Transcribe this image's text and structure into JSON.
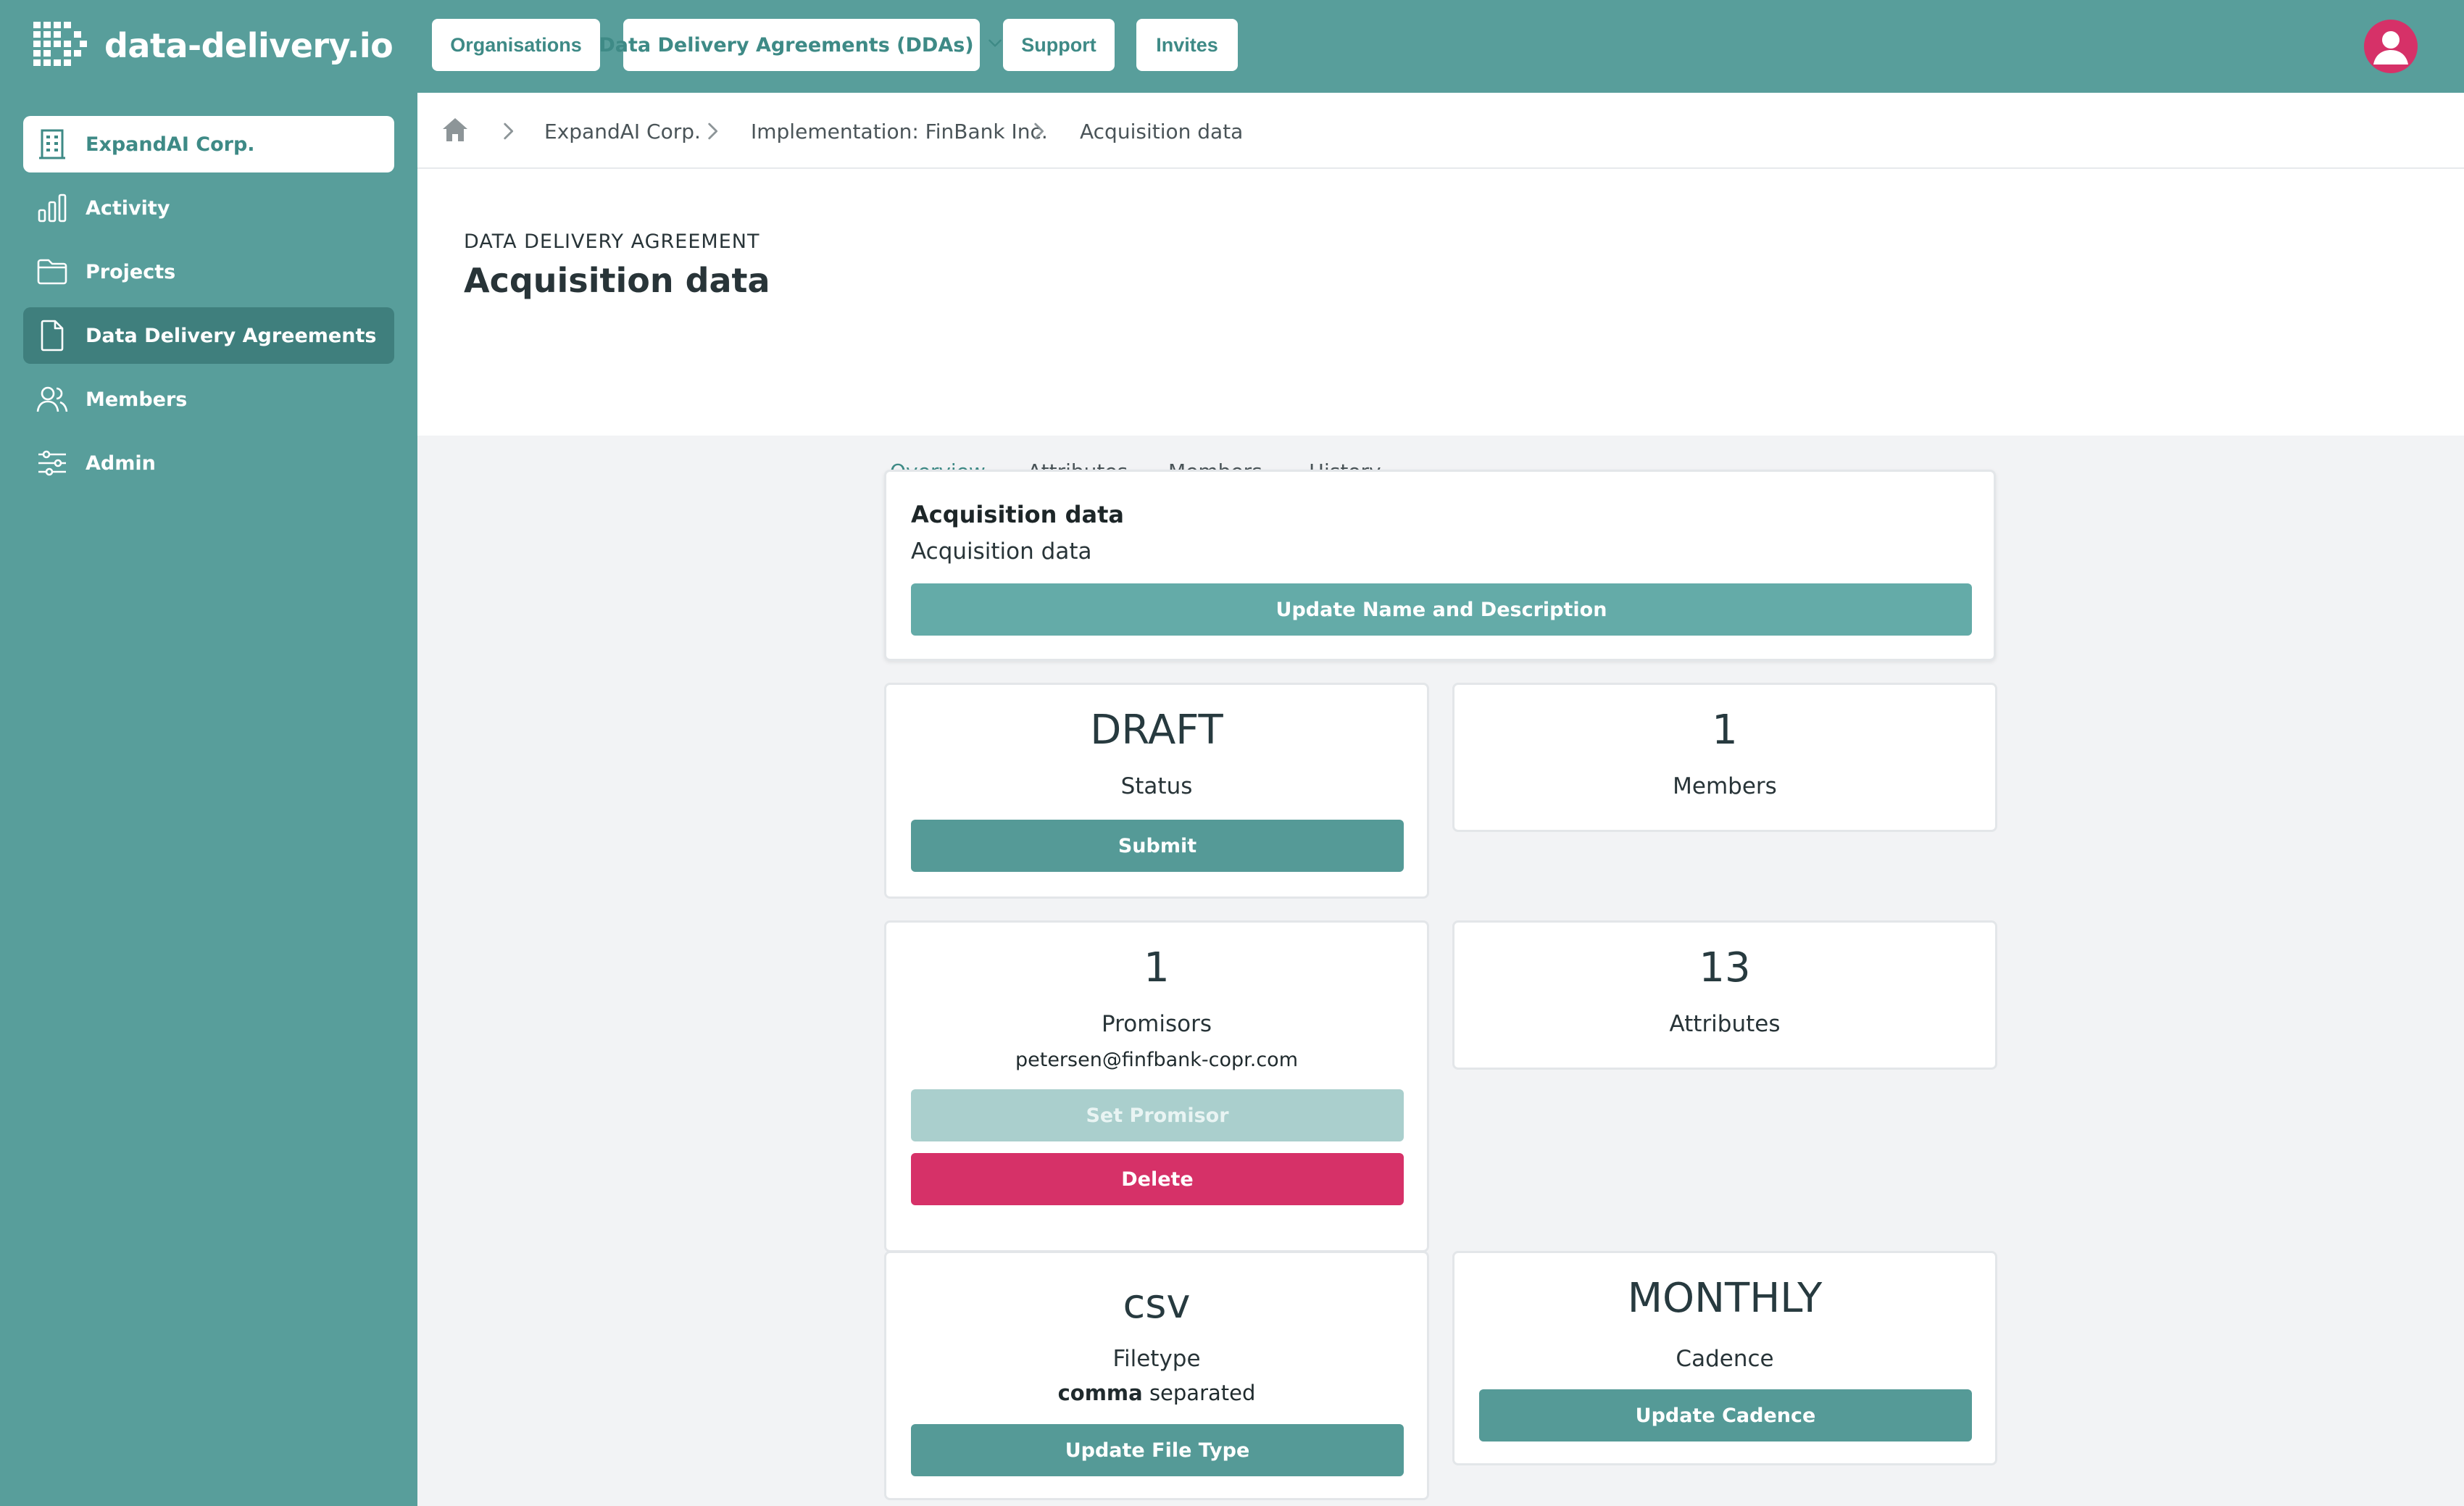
{
  "app": {
    "logo_text": "data-delivery.io"
  },
  "topnav": {
    "organisations": "Organisations",
    "ddas": "Data Delivery Agreements (DDAs)",
    "support": "Support",
    "invites": "Invites"
  },
  "sidebar": {
    "org": "ExpandAI Corp.",
    "items": [
      {
        "label": "Activity",
        "icon": "bar-chart-icon"
      },
      {
        "label": "Projects",
        "icon": "folder-icon"
      },
      {
        "label": "Data Delivery Agreements",
        "icon": "document-icon"
      },
      {
        "label": "Members",
        "icon": "users-icon"
      },
      {
        "label": "Admin",
        "icon": "sliders-icon"
      }
    ]
  },
  "breadcrumb": {
    "items": [
      "ExpandAI Corp.",
      "Implementation: FinBank Inc.",
      "Acquisition data"
    ]
  },
  "header": {
    "overline": "DATA DELIVERY AGREEMENT",
    "title": "Acquisition data"
  },
  "tabs": [
    "Overview",
    "Attributes",
    "Members",
    "History"
  ],
  "summary": {
    "name": "Acquisition data",
    "description": "Acquisition data",
    "update_label": "Update Name and Description"
  },
  "status_card": {
    "value": "DRAFT",
    "label": "Status",
    "button": "Submit"
  },
  "members_card": {
    "value": "1",
    "label": "Members"
  },
  "promisors_card": {
    "value": "1",
    "label": "Promisors",
    "email": "petersen@finfbank-copr.com",
    "set_button": "Set Promisor",
    "delete_button": "Delete"
  },
  "attributes_card": {
    "value": "13",
    "label": "Attributes"
  },
  "filetype_card": {
    "value": "csv",
    "label": "Filetype",
    "separator_bold": "comma",
    "separator_rest": "separated",
    "button": "Update File Type"
  },
  "cadence_card": {
    "value": "MONTHLY",
    "label": "Cadence",
    "button": "Update Cadence"
  },
  "colors": {
    "brand": "#589e9b",
    "accent": "#3e8a86",
    "danger": "#d63168"
  }
}
